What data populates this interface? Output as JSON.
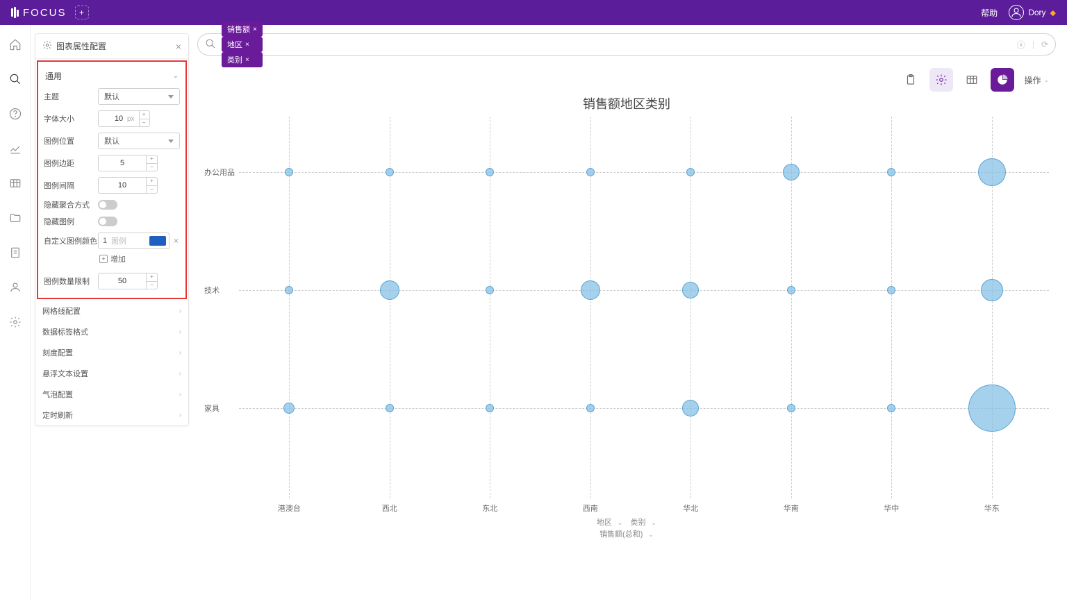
{
  "app": {
    "name": "FOCUS",
    "help": "帮助",
    "user": "Dory"
  },
  "panel": {
    "title": "图表属性配置",
    "section_general": "通用",
    "theme_label": "主题",
    "theme_value": "默认",
    "font_label": "字体大小",
    "font_value": "10",
    "font_unit": "px",
    "legend_pos_label": "图例位置",
    "legend_pos_value": "默认",
    "legend_margin_label": "图例边距",
    "legend_margin_value": "5",
    "legend_gap_label": "图例间隔",
    "legend_gap_value": "10",
    "hide_agg_label": "隐藏聚合方式",
    "hide_legend_label": "隐藏图例",
    "custom_color_label": "自定义图例颜色",
    "color_idx": "1",
    "color_placeholder": "图例",
    "color_hex": "#1f5fbf",
    "add_label": "增加",
    "legend_limit_label": "图例数量限制",
    "legend_limit_value": "50",
    "collapsed": [
      "网格线配置",
      "数据标签格式",
      "刻度配置",
      "悬浮文本设置",
      "气泡配置",
      "定时刷新"
    ]
  },
  "query": {
    "pills": [
      "销售额",
      "地区",
      "类别"
    ]
  },
  "toolbar": {
    "operate": "操作"
  },
  "chart_data": {
    "type": "scatter",
    "title": "销售额地区类别",
    "x_categories": [
      "港澳台",
      "西北",
      "东北",
      "西南",
      "华北",
      "华南",
      "华中",
      "华东"
    ],
    "y_categories": [
      "办公用品",
      "技术",
      "家具"
    ],
    "points": [
      {
        "x": 0,
        "y": 0,
        "r": 6
      },
      {
        "x": 1,
        "y": 0,
        "r": 6
      },
      {
        "x": 2,
        "y": 0,
        "r": 6
      },
      {
        "x": 3,
        "y": 0,
        "r": 6
      },
      {
        "x": 4,
        "y": 0,
        "r": 6
      },
      {
        "x": 5,
        "y": 0,
        "r": 12
      },
      {
        "x": 6,
        "y": 0,
        "r": 6
      },
      {
        "x": 7,
        "y": 0,
        "r": 20
      },
      {
        "x": 0,
        "y": 1,
        "r": 6
      },
      {
        "x": 1,
        "y": 1,
        "r": 14
      },
      {
        "x": 2,
        "y": 1,
        "r": 6
      },
      {
        "x": 3,
        "y": 1,
        "r": 14
      },
      {
        "x": 4,
        "y": 1,
        "r": 12
      },
      {
        "x": 5,
        "y": 1,
        "r": 6
      },
      {
        "x": 6,
        "y": 1,
        "r": 6
      },
      {
        "x": 7,
        "y": 1,
        "r": 16
      },
      {
        "x": 0,
        "y": 2,
        "r": 8
      },
      {
        "x": 1,
        "y": 2,
        "r": 6
      },
      {
        "x": 2,
        "y": 2,
        "r": 6
      },
      {
        "x": 3,
        "y": 2,
        "r": 6
      },
      {
        "x": 4,
        "y": 2,
        "r": 12
      },
      {
        "x": 5,
        "y": 2,
        "r": 6
      },
      {
        "x": 6,
        "y": 2,
        "r": 6
      },
      {
        "x": 7,
        "y": 2,
        "r": 34
      }
    ],
    "footer": {
      "dim1": "地区",
      "dim2": "类别",
      "measure": "销售额(总和)"
    }
  }
}
